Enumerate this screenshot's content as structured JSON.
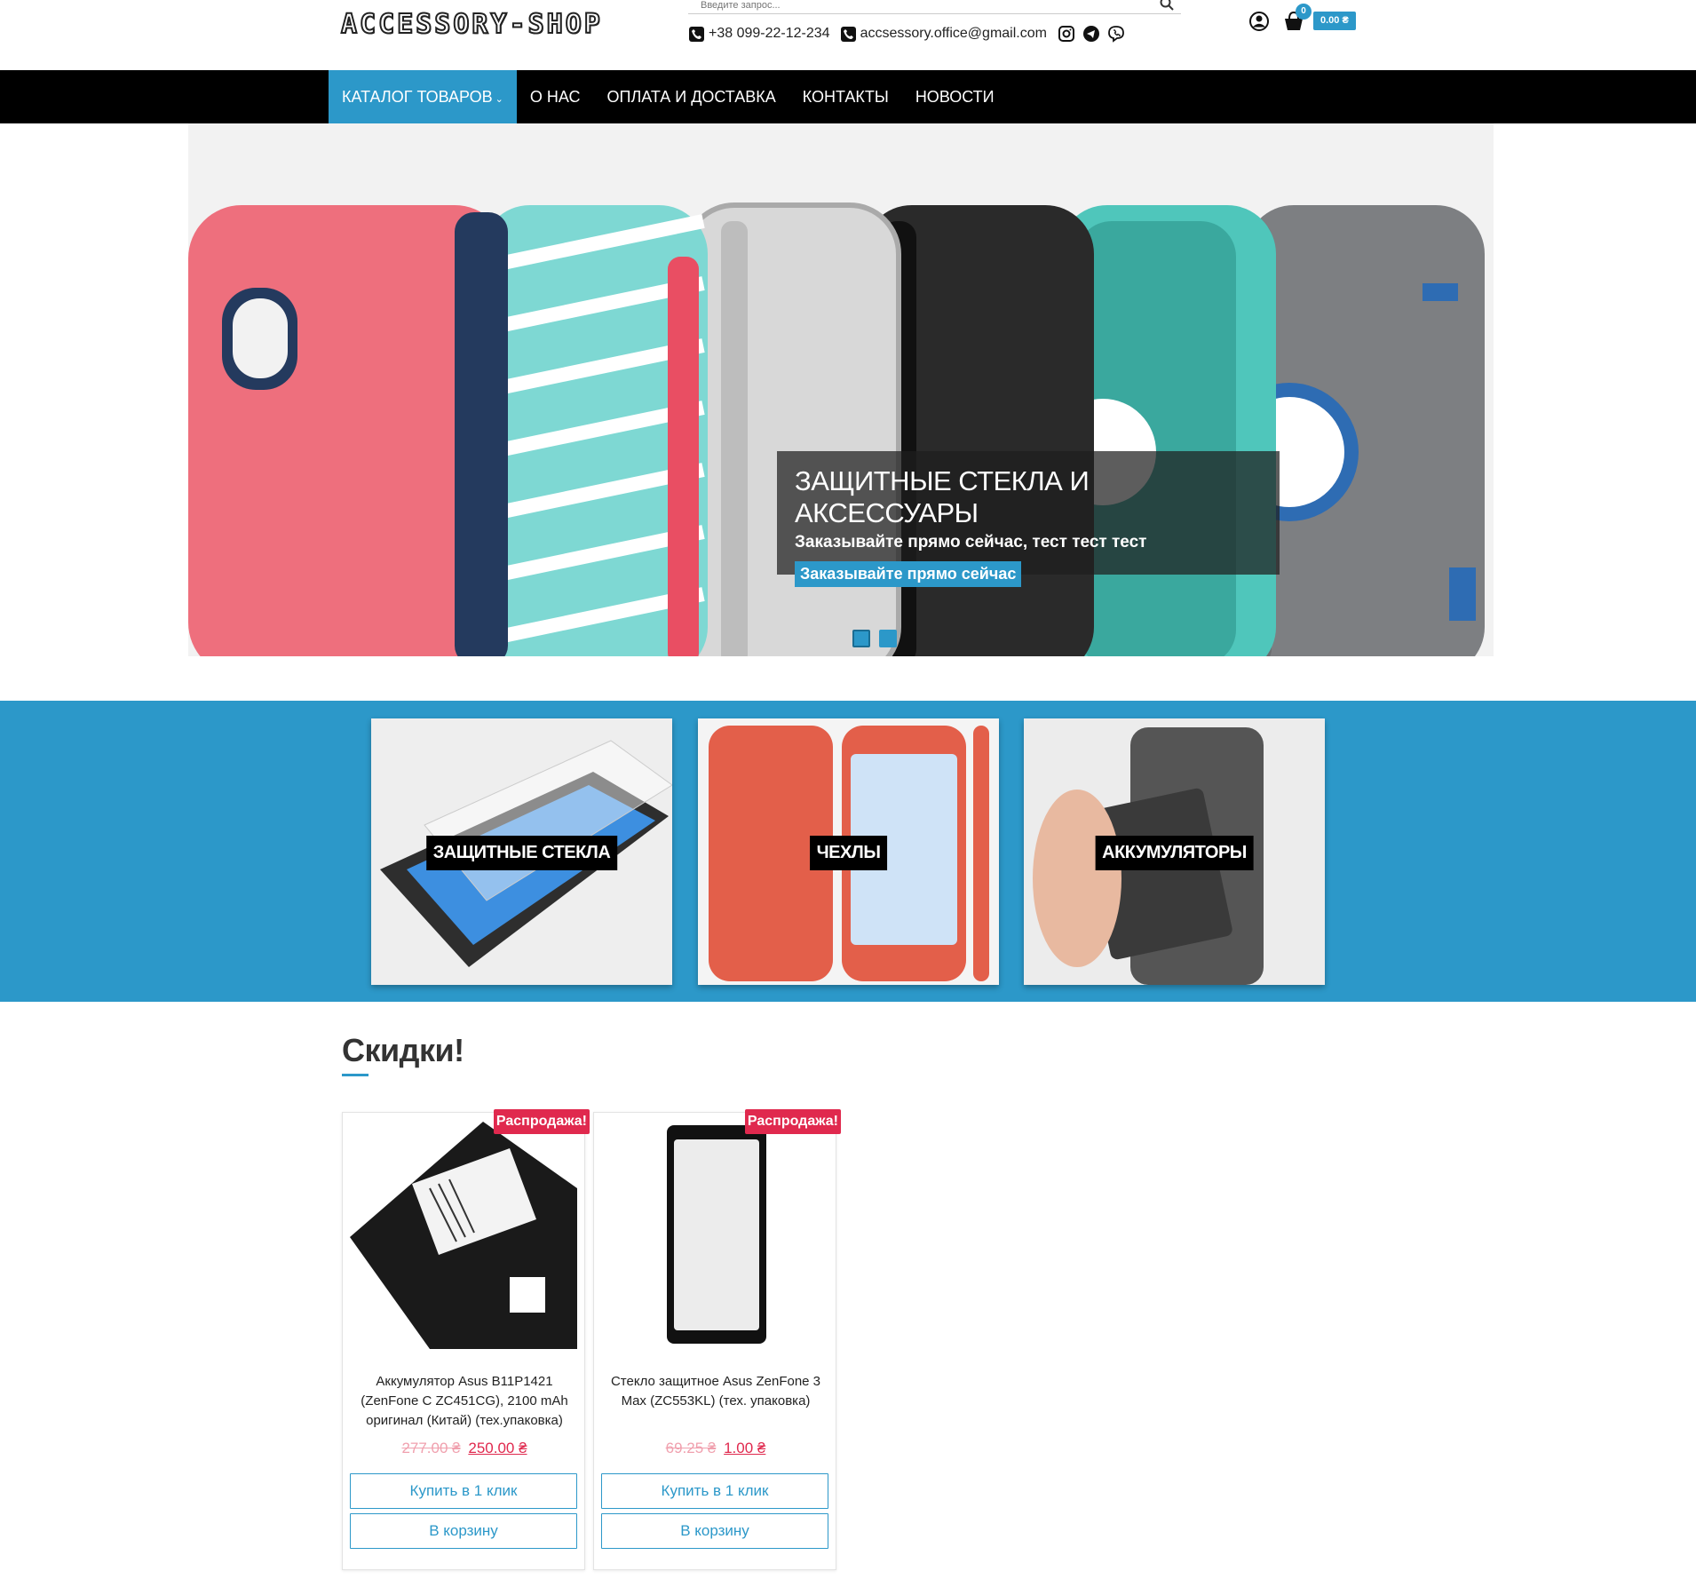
{
  "header": {
    "logo": "ACCESSORY-SHOP",
    "search_placeholder": "Введите запрос...",
    "phone": "+38 099-22-12-234",
    "email": "accsessory.office@gmail.com",
    "cart_count": "0",
    "cart_total": "0.00 ₴"
  },
  "nav": {
    "items": [
      {
        "label": "КАТАЛОГ ТОВАРОВ"
      },
      {
        "label": "О НАС"
      },
      {
        "label": "ОПЛАТА И ДОСТАВКА"
      },
      {
        "label": "КОНТАКТЫ"
      },
      {
        "label": "НОВОСТИ"
      }
    ]
  },
  "slider": {
    "title": "ЗАЩИТНЫЕ СТЕКЛА И АКСЕССУАРЫ",
    "subtitle": "Заказывайте прямо сейчас, тест тест тест",
    "button": "Заказывайте прямо сейчас"
  },
  "categories": [
    {
      "label": "ЗАЩИТНЫЕ СТЕКЛА"
    },
    {
      "label": "ЧЕХЛЫ"
    },
    {
      "label": "АККУМУЛЯТОРЫ"
    }
  ],
  "discounts": {
    "title": "Скидки!",
    "products": [
      {
        "badge": "Распродажа!",
        "name": "Аккумулятор Asus B11P1421 (ZenFone C ZC451CG), 2100 mAh оригинал (Китай) (тех.упаковка)",
        "old_price": "277.00 ₴",
        "new_price": "250.00 ₴",
        "buy_one_click": "Купить в 1 клик",
        "add_to_cart": "В корзину"
      },
      {
        "badge": "Распродажа!",
        "name": "Стекло защитное Asus ZenFone 3 Max (ZC553KL) (тех. упаковка)",
        "old_price": "69.25 ₴",
        "new_price": "1.00 ₴",
        "buy_one_click": "Купить в 1 клик",
        "add_to_cart": "В корзину"
      }
    ]
  },
  "colors": {
    "accent": "#2c98c9",
    "sale": "#e0294e",
    "nav_bg": "#000000"
  }
}
